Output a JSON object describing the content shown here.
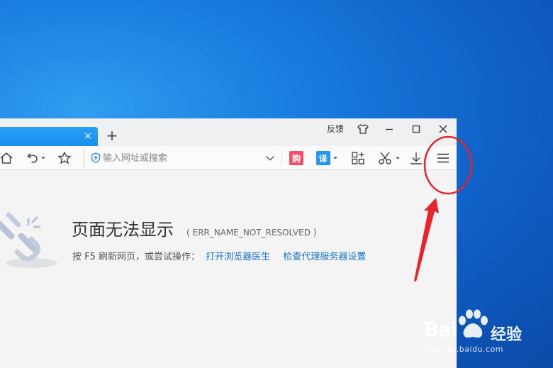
{
  "browser": {
    "titlebar": {
      "tab_close": "×",
      "new_tab": "+",
      "feedback": "反馈"
    },
    "toolbar": {
      "address_placeholder": "输入网址或搜索",
      "shop_badge": "购",
      "translate_badge": "译"
    },
    "page": {
      "error_title": "页面无法显示",
      "error_code": "( ERR_NAME_NOT_RESOLVED )",
      "hint_prefix": "按 F5 刷新网页，或尝试操作：",
      "link_doctor": "打开浏览器医生",
      "link_proxy": "检查代理服务器设置"
    }
  },
  "watermark": {
    "brand": "Bai",
    "jingyan": "经验",
    "url": "jingyan.baidu.com"
  },
  "colors": {
    "desktop": "#1a7fe0",
    "tab_active": "#1890ef",
    "link": "#1a73c8",
    "annotation": "#e8232a",
    "shop_badge": "#f0506e",
    "translate_badge": "#2196f3"
  }
}
